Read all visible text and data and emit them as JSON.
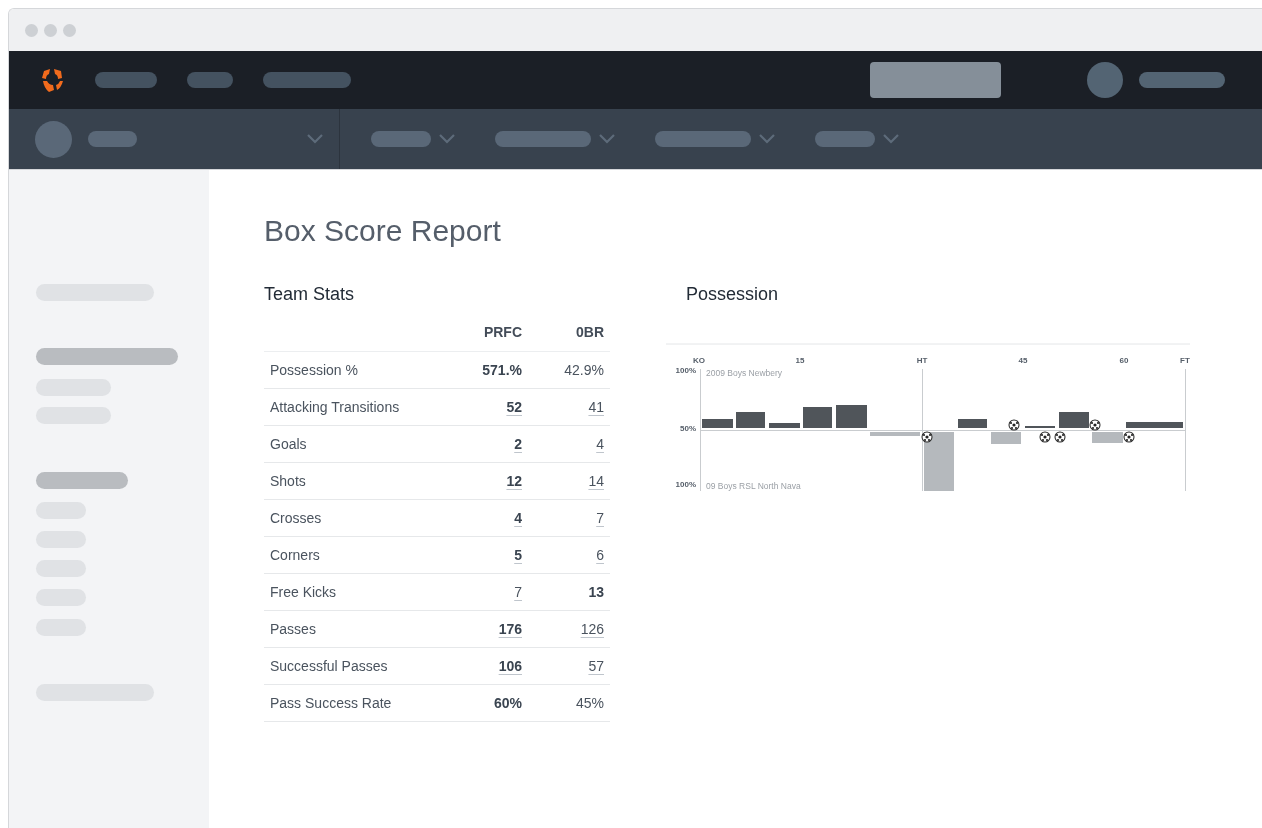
{
  "page": {
    "title": "Box Score Report"
  },
  "team_stats": {
    "title": "Team Stats",
    "columns": [
      "PRFC",
      "0BR"
    ],
    "rows": [
      {
        "label": "Possession %",
        "values": [
          {
            "text": "571.%",
            "bold": true,
            "link": false
          },
          {
            "text": "42.9%",
            "bold": false,
            "link": false
          }
        ]
      },
      {
        "label": "Attacking Transitions",
        "values": [
          {
            "text": "52",
            "bold": true,
            "link": true
          },
          {
            "text": "41",
            "bold": false,
            "link": true
          }
        ]
      },
      {
        "label": "Goals",
        "values": [
          {
            "text": "2",
            "bold": true,
            "link": true
          },
          {
            "text": "4",
            "bold": false,
            "link": true
          }
        ]
      },
      {
        "label": "Shots",
        "values": [
          {
            "text": "12",
            "bold": true,
            "link": true
          },
          {
            "text": "14",
            "bold": false,
            "link": true
          }
        ]
      },
      {
        "label": "Crosses",
        "values": [
          {
            "text": "4",
            "bold": true,
            "link": true
          },
          {
            "text": "7",
            "bold": false,
            "link": true
          }
        ]
      },
      {
        "label": "Corners",
        "values": [
          {
            "text": "5",
            "bold": true,
            "link": true
          },
          {
            "text": "6",
            "bold": false,
            "link": true
          }
        ]
      },
      {
        "label": "Free Kicks",
        "values": [
          {
            "text": "7",
            "bold": false,
            "link": true
          },
          {
            "text": "13",
            "bold": true,
            "link": false
          }
        ]
      },
      {
        "label": "Passes",
        "values": [
          {
            "text": "176",
            "bold": true,
            "link": true
          },
          {
            "text": "126",
            "bold": false,
            "link": true
          }
        ]
      },
      {
        "label": "Successful Passes",
        "values": [
          {
            "text": "106",
            "bold": true,
            "link": true
          },
          {
            "text": "57",
            "bold": false,
            "link": true
          }
        ]
      },
      {
        "label": "Pass Success Rate",
        "values": [
          {
            "text": "60%",
            "bold": true,
            "link": false
          },
          {
            "text": "45%",
            "bold": false,
            "link": false
          }
        ]
      }
    ]
  },
  "possession": {
    "title": "Possession",
    "time_labels": [
      "KO",
      "15",
      "HT",
      "45",
      "60",
      "FT"
    ],
    "y_labels": [
      "100%",
      "50%",
      "100%"
    ],
    "home_team": "2009 Boys Newbery",
    "away_team": "09 Boys RSL North Nava"
  }
}
